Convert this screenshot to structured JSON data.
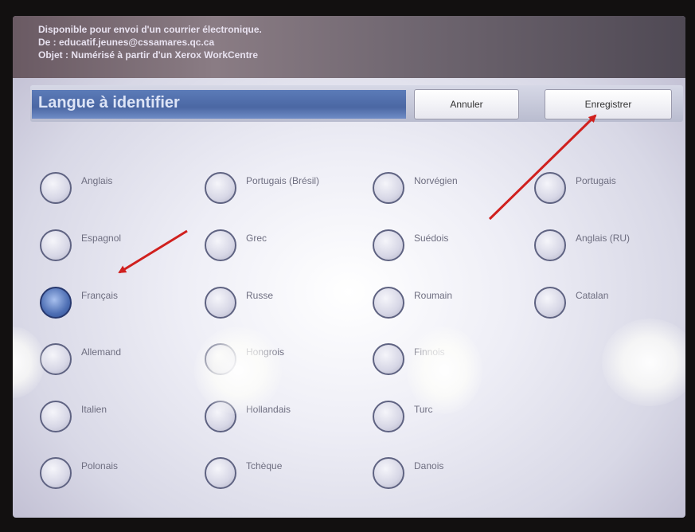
{
  "header": {
    "line1": "Disponible pour envoi d'un courrier électronique.",
    "line2": "De : educatif.jeunes@cssamares.qc.ca",
    "line3": "Objet : Numérisé à partir d'un Xerox WorkCentre"
  },
  "titlebar": {
    "title": "Langue à identifier",
    "cancel_label": "Annuler",
    "save_label": "Enregistrer"
  },
  "languages": [
    {
      "label": "Anglais",
      "selected": false
    },
    {
      "label": "Portugais (Brésil)",
      "selected": false
    },
    {
      "label": "Norvégien",
      "selected": false
    },
    {
      "label": "Portugais",
      "selected": false
    },
    {
      "label": "Espagnol",
      "selected": false
    },
    {
      "label": "Grec",
      "selected": false
    },
    {
      "label": "Suédois",
      "selected": false
    },
    {
      "label": "Anglais (RU)",
      "selected": false
    },
    {
      "label": "Français",
      "selected": true
    },
    {
      "label": "Russe",
      "selected": false
    },
    {
      "label": "Roumain",
      "selected": false
    },
    {
      "label": "Catalan",
      "selected": false
    },
    {
      "label": "Allemand",
      "selected": false
    },
    {
      "label": "Hongrois",
      "selected": false
    },
    {
      "label": "Finnois",
      "selected": false
    },
    {
      "label": "Italien",
      "selected": false
    },
    {
      "label": "Hollandais",
      "selected": false
    },
    {
      "label": "Turc",
      "selected": false
    },
    {
      "label": "Polonais",
      "selected": false
    },
    {
      "label": "Tchèque",
      "selected": false
    },
    {
      "label": "Danois",
      "selected": false
    }
  ],
  "colors": {
    "annotation_arrow": "#d0201e",
    "selected_radio": "#4e6fb4",
    "title_field": "#4b67a3"
  }
}
